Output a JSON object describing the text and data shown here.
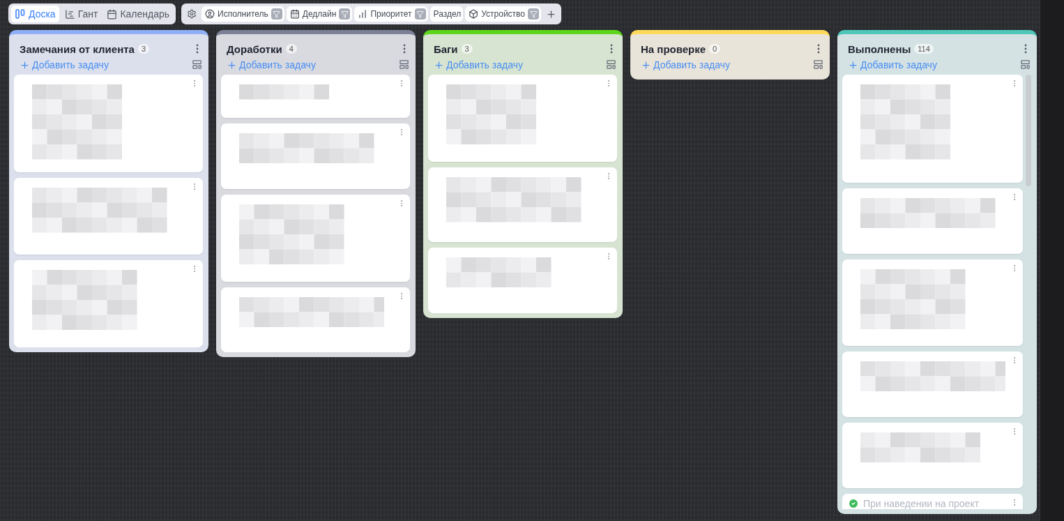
{
  "views": [
    {
      "label": "Доска",
      "selected": true
    },
    {
      "label": "Гант",
      "selected": false
    },
    {
      "label": "Календарь",
      "selected": false
    }
  ],
  "filters": [
    {
      "label": "Исполнитель",
      "kind": "filter"
    },
    {
      "label": "Дедлайн",
      "kind": "filter"
    },
    {
      "label": "Приоритет",
      "kind": "filter"
    },
    {
      "label": "Раздел",
      "kind": "plain"
    },
    {
      "label": "Устройство",
      "kind": "filter"
    }
  ],
  "columns": [
    {
      "title": "Замечания от клиента",
      "count": "3",
      "color": "#8fb0f7",
      "add_label": "Добавить задачу",
      "cards": [
        {
          "kind": "redacted"
        },
        {
          "kind": "redacted"
        },
        {
          "kind": "redacted"
        }
      ]
    },
    {
      "title": "Доработки",
      "count": "4",
      "color": "#7c8197",
      "add_label": "Добавить задачу",
      "cards": [
        {
          "kind": "redacted"
        },
        {
          "kind": "redacted"
        },
        {
          "kind": "redacted"
        },
        {
          "kind": "redacted"
        }
      ]
    },
    {
      "title": "Баги",
      "count": "3",
      "color": "#5dd61c",
      "add_label": "Добавить задачу",
      "cards": [
        {
          "kind": "redacted"
        },
        {
          "kind": "redacted"
        },
        {
          "kind": "redacted"
        }
      ]
    },
    {
      "title": "На проверке",
      "count": "0",
      "color": "#ffd95c",
      "add_label": "Добавить задачу"
    },
    {
      "title": "Выполнены",
      "count": "114",
      "color": "#4fc7b9",
      "add_label": "Добавить задачу",
      "cards": [
        {
          "kind": "redacted"
        },
        {
          "kind": "redacted"
        },
        {
          "kind": "redacted"
        },
        {
          "kind": "redacted"
        },
        {
          "kind": "redacted"
        },
        {
          "kind": "task",
          "title": "При наведении на проект",
          "done": true
        }
      ]
    }
  ]
}
